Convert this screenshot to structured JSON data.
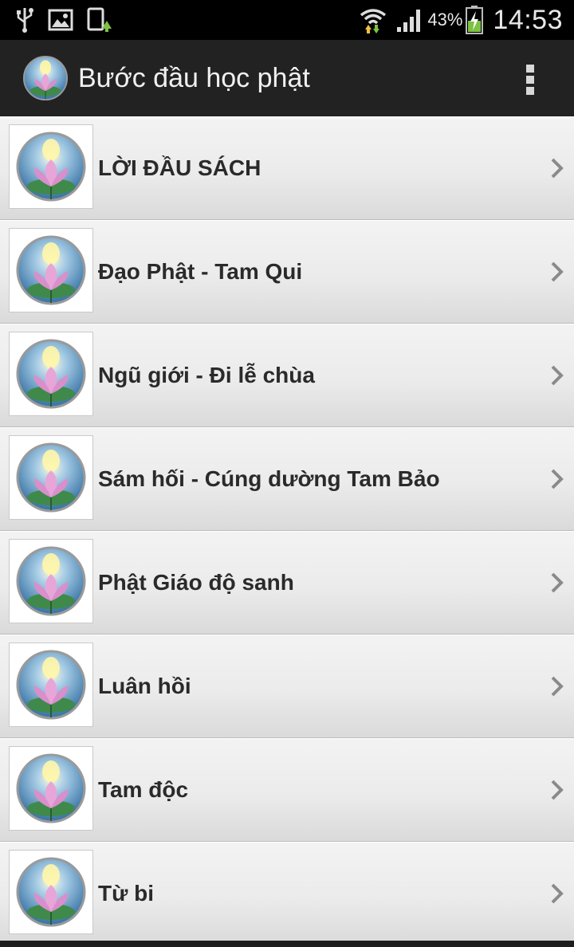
{
  "status_bar": {
    "left_icons": [
      "usb-icon",
      "image-icon",
      "sync-icon"
    ],
    "battery_percent": "43%",
    "time": "14:53"
  },
  "action_bar": {
    "title": "Bước đầu học phật",
    "app_icon": "lotus-icon",
    "overflow_icon": "more-vert-icon"
  },
  "list": {
    "items": [
      {
        "label": "LỜI ĐẦU SÁCH"
      },
      {
        "label": "Đạo Phật - Tam Qui"
      },
      {
        "label": "Ngũ giới - Đi lễ chùa"
      },
      {
        "label": "Sám hối - Cúng dường Tam Bảo"
      },
      {
        "label": "Phật Giáo độ sanh"
      },
      {
        "label": "Luân hồi"
      },
      {
        "label": "Tam độc"
      },
      {
        "label": "Từ bi"
      }
    ],
    "item_icon": "lotus-icon",
    "chevron_icon": "chevron-right-icon"
  }
}
